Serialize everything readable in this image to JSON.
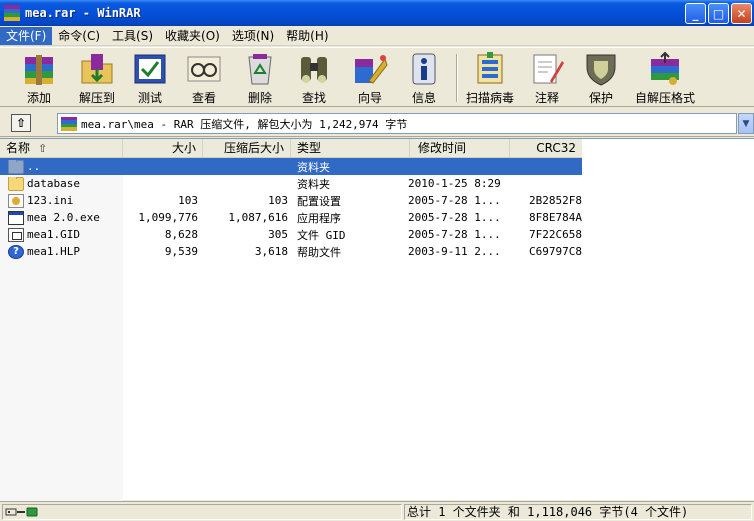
{
  "window": {
    "title": "mea.rar - WinRAR",
    "controls": {
      "minimize": "_",
      "maximize": "□",
      "close": "✕"
    }
  },
  "menu": [
    {
      "label": "文件(F)",
      "active": true
    },
    {
      "label": "命令(C)"
    },
    {
      "label": "工具(S)"
    },
    {
      "label": "收藏夹(O)"
    },
    {
      "label": "选项(N)"
    },
    {
      "label": "帮助(H)"
    }
  ],
  "toolbar": {
    "add": "添加",
    "extract": "解压到",
    "test": "测试",
    "view": "查看",
    "delete": "删除",
    "find": "查找",
    "wizard": "向导",
    "info": "信息",
    "virus_scan": "扫描病毒",
    "comment": "注释",
    "protect": "保护",
    "sfx": "自解压格式"
  },
  "address": {
    "up_glyph": "⇧",
    "path": "mea.rar\\mea - RAR 压缩文件, 解包大小为 1,242,974 字节",
    "dropdown_glyph": "▼"
  },
  "columns": {
    "name": "名称",
    "sort_glyph": "⇧",
    "size": "大小",
    "packed": "压缩后大小",
    "type": "类型",
    "modified": "修改时间",
    "crc": "CRC32"
  },
  "files": [
    {
      "icon": "folder-up-icon",
      "name": "..",
      "size": "",
      "packed": "",
      "type": "资料夹",
      "modified": "",
      "crc": ""
    },
    {
      "icon": "folder-icon",
      "name": "database",
      "size": "",
      "packed": "",
      "type": "资料夹",
      "modified": "2010-1-25 8:29",
      "crc": ""
    },
    {
      "icon": "ini-file-icon",
      "name": "123.ini",
      "size": "103",
      "packed": "103",
      "type": "配置设置",
      "modified": "2005-7-28 1...",
      "crc": "2B2852F8"
    },
    {
      "icon": "exe-file-icon",
      "name": "mea 2.0.exe",
      "size": "1,099,776",
      "packed": "1,087,616",
      "type": "应用程序",
      "modified": "2005-7-28 1...",
      "crc": "8F8E784A"
    },
    {
      "icon": "gid-file-icon",
      "name": "mea1.GID",
      "size": "8,628",
      "packed": "305",
      "type": "文件 GID",
      "modified": "2005-7-28 1...",
      "crc": "7F22C658"
    },
    {
      "icon": "help-file-icon",
      "name": "mea1.HLP",
      "size": "9,539",
      "packed": "3,618",
      "type": "帮助文件",
      "modified": "2003-9-11 2...",
      "crc": "C69797C8"
    }
  ],
  "help_icon_glyph": "?",
  "status": {
    "summary": "总计 1 个文件夹 和 1,118,046 字节(4 个文件)"
  }
}
